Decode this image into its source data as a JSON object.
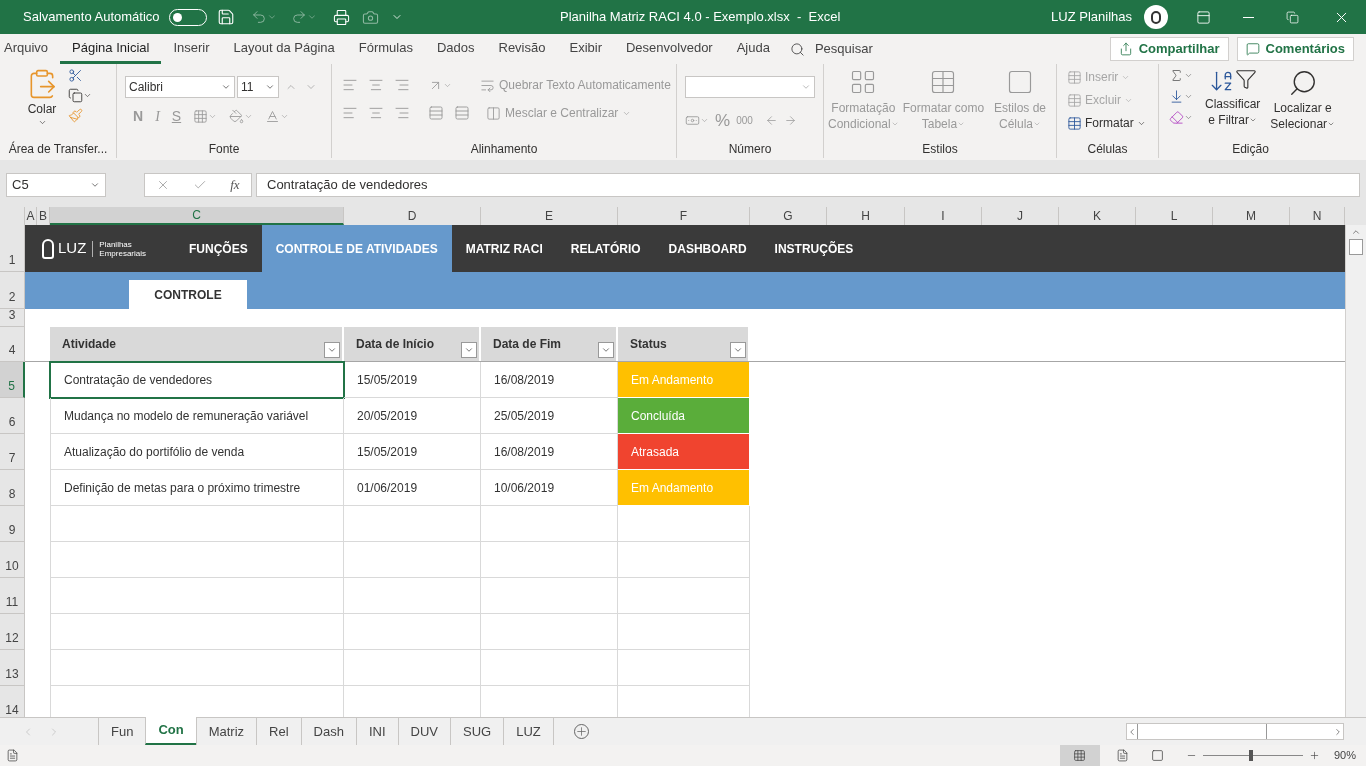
{
  "title_bar": {
    "autosave_label": "Salvamento Automático",
    "autosave_on": false,
    "title": "Planilha Matriz RACI 4.0 - Exemplo.xlsx  -  Excel",
    "user": "LUZ Planilhas"
  },
  "menu_tabs": [
    {
      "label": "Arquivo",
      "selected": false
    },
    {
      "label": "Página Inicial",
      "selected": true
    },
    {
      "label": "Inserir",
      "selected": false
    },
    {
      "label": "Layout da Página",
      "selected": false
    },
    {
      "label": "Fórmulas",
      "selected": false
    },
    {
      "label": "Dados",
      "selected": false
    },
    {
      "label": "Revisão",
      "selected": false
    },
    {
      "label": "Exibir",
      "selected": false
    },
    {
      "label": "Desenvolvedor",
      "selected": false
    },
    {
      "label": "Ajuda",
      "selected": false
    }
  ],
  "search": {
    "placeholder": "Pesquisar"
  },
  "share_button": "Compartilhar",
  "comments_button": "Comentários",
  "ribbon": {
    "clipboard": {
      "paste": "Colar",
      "label": "Área de Transfer..."
    },
    "font": {
      "font_name": "Calibri",
      "font_size": "11",
      "bold": "N",
      "italic": "I",
      "underline": "S",
      "label": "Fonte"
    },
    "alignment": {
      "wrap": "Quebrar Texto Automaticamente",
      "merge": "Mesclar e Centralizar",
      "label": "Alinhamento"
    },
    "number": {
      "percent": "%",
      "thousands": "000",
      "label": "Número"
    },
    "styles": {
      "items": [
        {
          "lines": [
            "Formatação",
            "Condicional"
          ]
        },
        {
          "lines": [
            "Formatar como",
            "Tabela"
          ]
        },
        {
          "lines": [
            "Estilos de",
            "Célula"
          ]
        }
      ],
      "label": "Estilos"
    },
    "cells": {
      "items": [
        {
          "label": "Inserir",
          "disabled": true
        },
        {
          "label": "Excluir",
          "disabled": true
        },
        {
          "label": "Formatar",
          "disabled": false
        }
      ],
      "label": "Células"
    },
    "editing": {
      "sort": [
        "Classificar",
        "e Filtrar"
      ],
      "find": [
        "Localizar e",
        "Selecionar"
      ],
      "label": "Edição"
    }
  },
  "formula_bar": {
    "name_box": "C5",
    "fx": "fx",
    "formula": "Contratação de vendedores"
  },
  "column_headers": [
    {
      "label": "A",
      "selected": false
    },
    {
      "label": "B",
      "selected": false
    },
    {
      "label": "C",
      "selected": true
    },
    {
      "label": "D",
      "selected": false
    },
    {
      "label": "E",
      "selected": false
    },
    {
      "label": "F",
      "selected": false
    },
    {
      "label": "G",
      "selected": false
    },
    {
      "label": "H",
      "selected": false
    },
    {
      "label": "I",
      "selected": false
    },
    {
      "label": "J",
      "selected": false
    },
    {
      "label": "K",
      "selected": false
    },
    {
      "label": "L",
      "selected": false
    },
    {
      "label": "M",
      "selected": false
    },
    {
      "label": "N",
      "selected": false
    }
  ],
  "row_numbers": [
    {
      "label": "1",
      "selected": false
    },
    {
      "label": "2",
      "selected": false
    },
    {
      "label": "3",
      "selected": false
    },
    {
      "label": "4",
      "selected": false
    },
    {
      "label": "5",
      "selected": true
    },
    {
      "label": "6",
      "selected": false
    },
    {
      "label": "7",
      "selected": false
    },
    {
      "label": "8",
      "selected": false
    },
    {
      "label": "9",
      "selected": false
    },
    {
      "label": "10",
      "selected": false
    },
    {
      "label": "11",
      "selected": false
    },
    {
      "label": "12",
      "selected": false
    },
    {
      "label": "13",
      "selected": false
    },
    {
      "label": "14",
      "selected": false
    }
  ],
  "nav": {
    "logo": "LUZ",
    "logo_sub": [
      "Planilhas",
      "Empresariais"
    ],
    "items": [
      {
        "label": "FUNÇÕES",
        "selected": false
      },
      {
        "label": "CONTROLE DE ATIVIDADES",
        "selected": true
      },
      {
        "label": "MATRIZ RACI",
        "selected": false
      },
      {
        "label": "RELATÓRIO",
        "selected": false
      },
      {
        "label": "DASHBOARD",
        "selected": false
      },
      {
        "label": "INSTRUÇÕES",
        "selected": false
      }
    ],
    "sub_tab": "CONTROLE"
  },
  "table": {
    "columns": [
      "Atividade",
      "Data de Início",
      "Data de Fim",
      "Status"
    ],
    "rows": [
      {
        "activity": "Contratação de vendedores",
        "start": "15/05/2019",
        "end": "16/08/2019",
        "status": "Em Andamento",
        "color": "#ffc000",
        "selected": true
      },
      {
        "activity": "Mudança no modelo de remuneração variável",
        "start": "20/05/2019",
        "end": "25/05/2019",
        "status": "Concluída",
        "color": "#5aad3a",
        "selected": false
      },
      {
        "activity": "Atualização do portifólio de venda",
        "start": "15/05/2019",
        "end": "16/08/2019",
        "status": "Atrasada",
        "color": "#f0442f",
        "selected": false
      },
      {
        "activity": "Definição de metas para o próximo trimestre",
        "start": "01/06/2019",
        "end": "10/06/2019",
        "status": "Em Andamento",
        "color": "#ffc000",
        "selected": false
      }
    ]
  },
  "sheet_tabs": [
    {
      "label": "Fun",
      "selected": false
    },
    {
      "label": "Con",
      "selected": true
    },
    {
      "label": "Matriz",
      "selected": false
    },
    {
      "label": "Rel",
      "selected": false
    },
    {
      "label": "Dash",
      "selected": false
    },
    {
      "label": "INI",
      "selected": false
    },
    {
      "label": "DUV",
      "selected": false
    },
    {
      "label": "SUG",
      "selected": false
    },
    {
      "label": "LUZ",
      "selected": false
    }
  ],
  "status_bar": {
    "zoom": "90%",
    "level": 0.46
  }
}
